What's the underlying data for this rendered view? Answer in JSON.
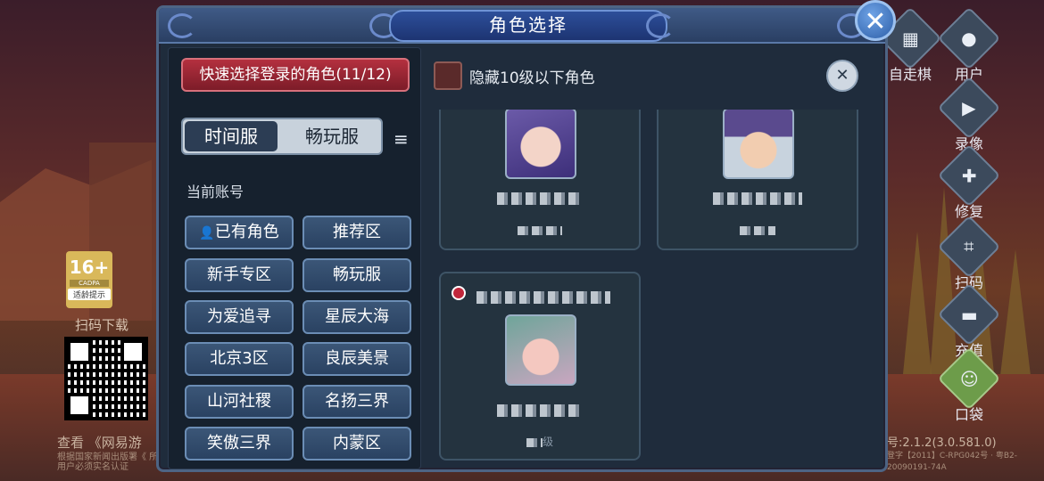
{
  "dialog": {
    "title": "角色选择",
    "close_label": "✕",
    "quick_select": "快速选择登录的角色(11/12)",
    "tabs": [
      {
        "label": "时间服",
        "active": true
      },
      {
        "label": "畅玩服",
        "active": false
      }
    ],
    "list_icon": "≡",
    "account_section": "当前账号",
    "servers": [
      {
        "label": "已有角色",
        "icon": "person-icon"
      },
      {
        "label": "推荐区"
      },
      {
        "label": "新手专区"
      },
      {
        "label": "畅玩服"
      },
      {
        "label": "为爱追寻"
      },
      {
        "label": "星辰大海"
      },
      {
        "label": "北京3区"
      },
      {
        "label": "良辰美景"
      },
      {
        "label": "山河社稷"
      },
      {
        "label": "名扬三界"
      },
      {
        "label": "笑傲三界"
      },
      {
        "label": "内蒙区"
      }
    ],
    "hide_low_level": "隐藏10级以下角色",
    "tool_icon": "wrench-icon",
    "roles": [
      {
        "name": "",
        "level": "",
        "avatar": "female-purple-hair-avatar",
        "last_login": false
      },
      {
        "name": "",
        "level": "",
        "avatar": "male-purple-hair-avatar",
        "last_login": false
      },
      {
        "name": "",
        "level": "级",
        "avatar": "female-green-hair-avatar",
        "last_login": true
      }
    ]
  },
  "side_menu": [
    {
      "label": "自走棋",
      "icon": "chess-icon"
    },
    {
      "label": "用户",
      "icon": "user-icon"
    },
    {
      "label": "录像",
      "icon": "video-icon"
    },
    {
      "label": "修复",
      "icon": "repair-icon"
    },
    {
      "label": "扫码",
      "icon": "scan-icon"
    },
    {
      "label": "充值",
      "icon": "wallet-icon"
    },
    {
      "label": "口袋",
      "icon": "pocket-icon"
    }
  ],
  "age_badge": {
    "rating": "16+",
    "org": "CADPA",
    "tip": "适龄提示"
  },
  "scan_download": "扫码下载",
  "footer": {
    "left_title": "查看 《网易游",
    "left_small": "根据国家新闻出版署《 所有用户必须实名认证",
    "version": "号:2.1.2(3.0.581.0)",
    "license": "登字【2011】C-RPG042号 · 粤B2-20090191-74A"
  },
  "colors": {
    "dialog_bg": "#1f2c3c",
    "accent_red": "#b4303f",
    "button_blue": "#3b5677",
    "title_blue": "#2d4f9a"
  }
}
